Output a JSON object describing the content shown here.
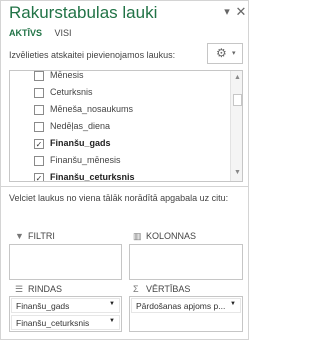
{
  "pane": {
    "title": "Rakurstabulas lauki",
    "dropdown_icon": "chevron-down-icon",
    "close_icon": "close-icon"
  },
  "tabs": [
    {
      "label": "AKTĪVS",
      "active": true
    },
    {
      "label": "VISI",
      "active": false
    }
  ],
  "prompt": "Izvēlieties atskaitei pievienojamos laukus:",
  "tools_icon": "gear-icon",
  "fields": [
    {
      "label": "Mēnesis",
      "checked": false,
      "bold": false
    },
    {
      "label": "Ceturksnis",
      "checked": false,
      "bold": false
    },
    {
      "label": "Mēneša_nosaukums",
      "checked": false,
      "bold": false
    },
    {
      "label": "Nedēļas_diena",
      "checked": false,
      "bold": false
    },
    {
      "label": "Finanšu_gads",
      "checked": true,
      "bold": true
    },
    {
      "label": "Finanšu_mēnesis",
      "checked": false,
      "bold": false
    },
    {
      "label": "Finanšu_ceturksnis",
      "checked": true,
      "bold": true
    }
  ],
  "drag_text": "Velciet laukus no viena tālāk norādītā apgabala uz citu:",
  "areas": {
    "filters": {
      "label": "FILTRI",
      "icon": "filter-icon",
      "items": []
    },
    "columns": {
      "label": "KOLONNAS",
      "icon": "columns-icon",
      "items": []
    },
    "rows": {
      "label": "RINDAS",
      "icon": "rows-icon",
      "items": [
        "Finanšu_gads",
        "Finanšu_ceturksnis"
      ]
    },
    "values": {
      "label": "VĒRTĪBAS",
      "icon": "sigma-icon",
      "items": [
        "Pārdošanas apjoms p..."
      ]
    }
  }
}
